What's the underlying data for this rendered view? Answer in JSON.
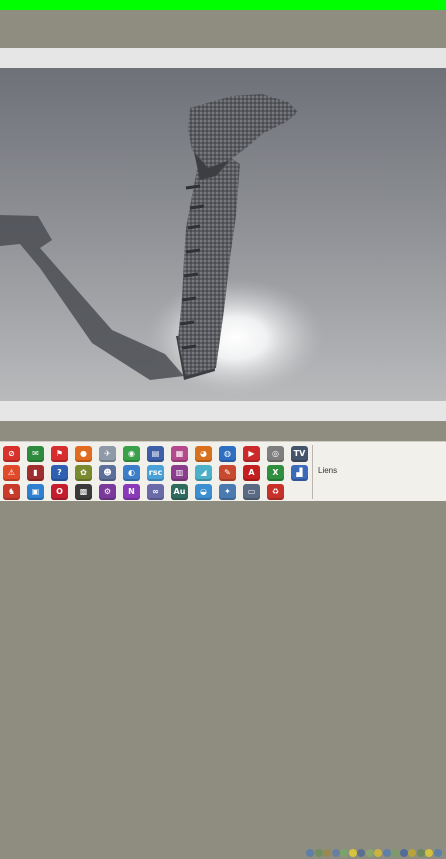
{
  "window": {
    "title_bar_color": "#00ff00",
    "band_color": "#8e8d80",
    "light_band_color": "#e6e6e6"
  },
  "viewport": {
    "description_icon": "3d-render-icon",
    "floor_color": "#8d8f94",
    "spotlight_color": "#ffffff",
    "model_color": "#5b5d62"
  },
  "tray": {
    "colors": [
      "#5d7fa8",
      "#6f8f63",
      "#9a8a50",
      "#6a7fa0",
      "#7aa36b",
      "#d6c43a",
      "#5b6f8f",
      "#8ba56e",
      "#c9b440",
      "#5d7fa8",
      "#7d9a6a",
      "#4f6d96",
      "#b8a23b",
      "#6b8a5a",
      "#d2c13e",
      "#5d7fa8"
    ]
  },
  "taskbar": {
    "links_label": "Liens",
    "icons": [
      {
        "name": "no-entry-icon",
        "color": "#d8302a",
        "glyph": "⊘"
      },
      {
        "name": "mail-icon",
        "color": "#2e8b3e",
        "glyph": "✉"
      },
      {
        "name": "flag-icon",
        "color": "#d62e2e",
        "glyph": "⚑"
      },
      {
        "name": "firefox-icon",
        "color": "#e26b1f",
        "glyph": "●"
      },
      {
        "name": "plane-icon",
        "color": "#8f9aa8",
        "glyph": "✈"
      },
      {
        "name": "chrome-icon",
        "color": "#3aa14a",
        "glyph": "◉"
      },
      {
        "name": "notepad-icon",
        "color": "#3f5ea8",
        "glyph": "▤"
      },
      {
        "name": "archive-icon",
        "color": "#b44a8c",
        "glyph": "▦"
      },
      {
        "name": "firefox-alt-icon",
        "color": "#d9701e",
        "glyph": "◕"
      },
      {
        "name": "globe-icon",
        "color": "#2f6fc2",
        "glyph": "◍"
      },
      {
        "name": "media-player-icon",
        "color": "#cc2a2a",
        "glyph": "▶"
      },
      {
        "name": "disc-icon",
        "color": "#7e7e7e",
        "glyph": "◎"
      },
      {
        "name": "tv-icon",
        "color": "#44556b",
        "glyph": "TV"
      },
      {
        "name": "warning-icon",
        "color": "#e04a2a",
        "glyph": "⚠"
      },
      {
        "name": "book-icon",
        "color": "#a02e2e",
        "glyph": "▮"
      },
      {
        "name": "help-icon",
        "color": "#2e5fb0",
        "glyph": "?"
      },
      {
        "name": "folder-tools-icon",
        "color": "#7a8a2e",
        "glyph": "✿"
      },
      {
        "name": "users-icon",
        "color": "#5c6e9a",
        "glyph": "☻"
      },
      {
        "name": "cleanup-icon",
        "color": "#3c7ec9",
        "glyph": "◐"
      },
      {
        "name": "rsc-icon",
        "color": "#4aa0d8",
        "glyph": "rsc"
      },
      {
        "name": "winrar-icon",
        "color": "#8a3d8c",
        "glyph": "▥"
      },
      {
        "name": "stats-icon",
        "color": "#4bb0c8",
        "glyph": "◢"
      },
      {
        "name": "pen-icon",
        "color": "#c84a2e",
        "glyph": "✎"
      },
      {
        "name": "pdf-icon",
        "color": "#c41e1e",
        "glyph": "A"
      },
      {
        "name": "excel-icon",
        "color": "#2f8f3e",
        "glyph": "X"
      },
      {
        "name": "chart-icon",
        "color": "#3a6ab8",
        "glyph": "▟"
      },
      {
        "name": "tool-icon",
        "color": "#c83a2a",
        "glyph": "♞"
      },
      {
        "name": "app-blue-icon",
        "color": "#2e7fd0",
        "glyph": "▣"
      },
      {
        "name": "opera-icon",
        "color": "#c41e2e",
        "glyph": "O"
      },
      {
        "name": "film-icon",
        "color": "#3a3a3a",
        "glyph": "▩"
      },
      {
        "name": "gear-icon",
        "color": "#7a3a9a",
        "glyph": "⚙"
      },
      {
        "name": "onenote-icon",
        "color": "#8a3ab8",
        "glyph": "N"
      },
      {
        "name": "infinity-icon",
        "color": "#6a6aa8",
        "glyph": "∞"
      },
      {
        "name": "audition-icon",
        "color": "#2f6a5e",
        "glyph": "Au"
      },
      {
        "name": "search-globe-icon",
        "color": "#3b8ed0",
        "glyph": "◒"
      },
      {
        "name": "network-icon",
        "color": "#4a7ab0",
        "glyph": "✦"
      },
      {
        "name": "screen-icon",
        "color": "#5a6a82",
        "glyph": "▭"
      },
      {
        "name": "recycle-bin-icon",
        "color": "#c8302a",
        "glyph": "♻"
      }
    ]
  }
}
